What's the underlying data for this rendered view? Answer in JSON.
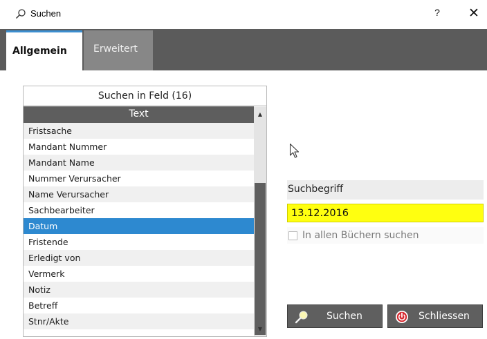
{
  "window": {
    "title": "Suchen",
    "help_label": "?",
    "close_label": "✕"
  },
  "tabs": [
    {
      "label": "Allgemein",
      "active": true
    },
    {
      "label": "Erweitert",
      "active": false
    }
  ],
  "field_list": {
    "caption": "Suchen in Feld (16)",
    "column_header": "Text",
    "selected_index": 6,
    "items": [
      "Fristsache",
      "Mandant Nummer",
      "Mandant Name",
      "Nummer Verursacher",
      "Name Verursacher",
      "Sachbearbeiter",
      "Datum",
      "Fristende",
      "Erledigt von",
      "Vermerk",
      "Notiz",
      "Betreff",
      "Stnr/Akte"
    ]
  },
  "search": {
    "label": "Suchbegriff",
    "value": "13.12.2016",
    "all_books_label": "In allen Büchern suchen",
    "all_books_checked": false
  },
  "buttons": {
    "search_label": "Suchen",
    "close_label": "Schliessen"
  },
  "colors": {
    "selection": "#2d89d0",
    "input_highlight": "#ffff10",
    "tab_accent": "#3c8fd0"
  },
  "icons": {
    "title": "search-icon",
    "search_button": "search-icon",
    "close_button": "power-icon",
    "scroll_up": "triangle-up-icon",
    "scroll_down": "triangle-down-icon"
  }
}
